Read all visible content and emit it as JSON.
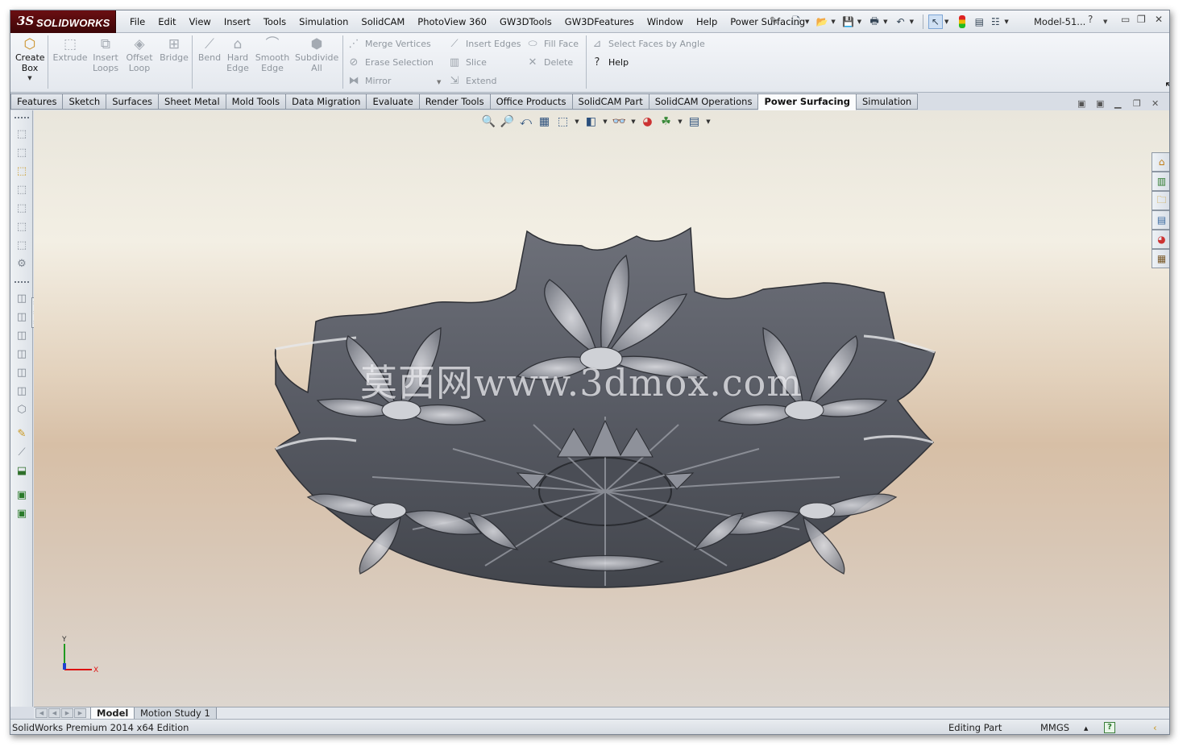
{
  "app": {
    "logo_mark": "3S",
    "logo_text": "SOLIDWORKS",
    "document_title": "Model-51..."
  },
  "menu": [
    "File",
    "Edit",
    "View",
    "Insert",
    "Tools",
    "Simulation",
    "SolidCAM",
    "PhotoView 360",
    "GW3DTools",
    "GW3DFeatures",
    "Window",
    "Help",
    "Power Surfacing"
  ],
  "ribbon": {
    "create_box": "Create Box",
    "extrude": "Extrude",
    "insert_loops": "Insert Loops",
    "offset_loop": "Offset Loop",
    "bridge": "Bridge",
    "bend": "Bend",
    "hard_edge": "Hard Edge",
    "smooth_edge": "Smooth Edge",
    "subdivide_all": "Subdivide All",
    "merge_vertices": "Merge Vertices",
    "erase_selection": "Erase Selection",
    "mirror": "Mirror",
    "insert_edges": "Insert Edges",
    "slice": "Slice",
    "extend": "Extend",
    "fill_face": "Fill Face",
    "delete": "Delete",
    "select_faces_by_angle": "Select Faces by Angle",
    "help": "Help"
  },
  "tabs": [
    "Features",
    "Sketch",
    "Surfaces",
    "Sheet Metal",
    "Mold Tools",
    "Data Migration",
    "Evaluate",
    "Render Tools",
    "Office Products",
    "SolidCAM Part",
    "SolidCAM Operations",
    "Power Surfacing",
    "Simulation"
  ],
  "active_tab": "Power Surfacing",
  "viewport": {
    "watermark": "莫西网www.3dmox.com",
    "triad_x": "X",
    "triad_y": "Y"
  },
  "bottom_tabs": {
    "model": "Model",
    "motion_study": "Motion Study 1"
  },
  "status": {
    "edition": "SolidWorks Premium 2014 x64 Edition",
    "mode": "Editing Part",
    "units": "MMGS",
    "units_arrow": "▲",
    "help": "?"
  },
  "colors": {
    "logo_bg": "#5a0a0d",
    "viewport_top": "#f3efe4",
    "viewport_mid": "#d7bfa6",
    "model_fill": "#5d6069"
  }
}
